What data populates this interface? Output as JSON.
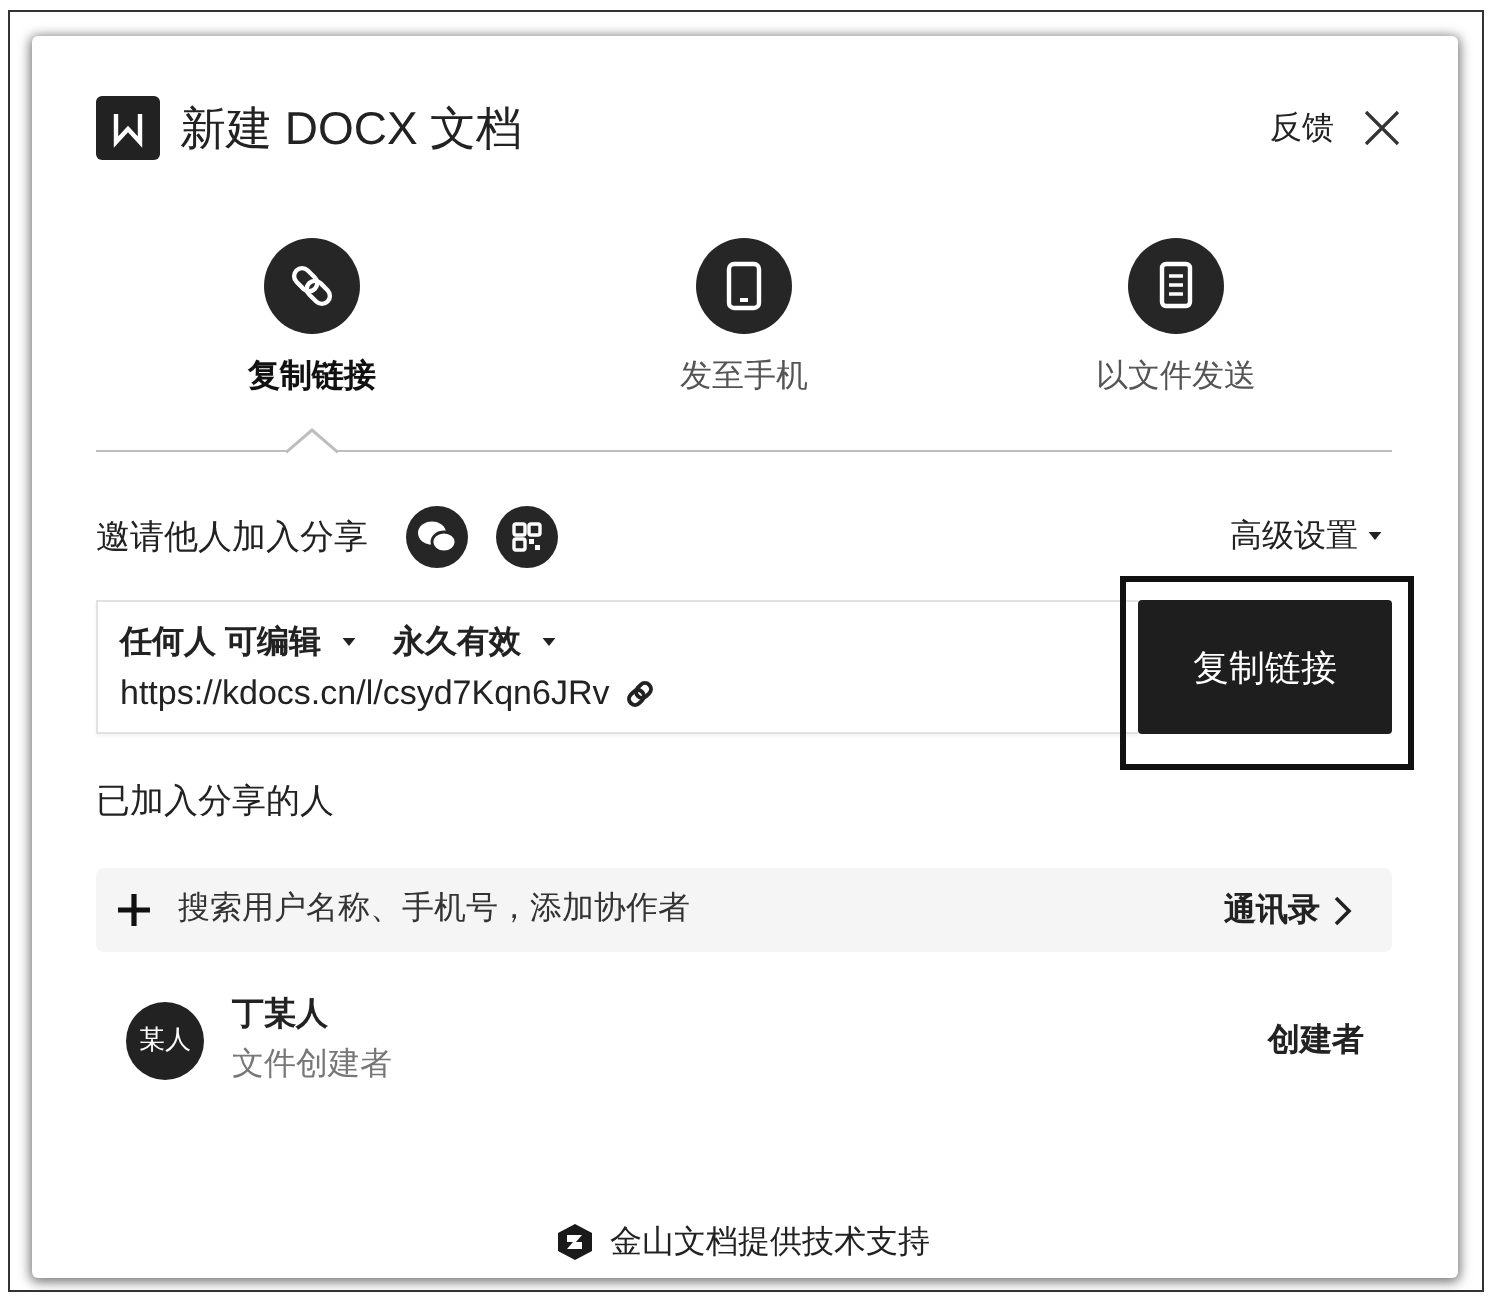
{
  "window": {
    "title": "新建 DOCX 文档",
    "feedback": "反馈"
  },
  "share_modes": [
    {
      "kind": "link",
      "label": "复制链接",
      "selected": true
    },
    {
      "kind": "phone",
      "label": "发至手机",
      "selected": false
    },
    {
      "kind": "file",
      "label": "以文件发送",
      "selected": false
    }
  ],
  "invite": {
    "label": "邀请他人加入分享",
    "advanced": "高级设置"
  },
  "link": {
    "access": "任何人 可编辑",
    "expiry": "永久有效",
    "url": "https://kdocs.cn/l/csyd7Kqn6JRv"
  },
  "copy_button": {
    "label": "复制链接",
    "highlighted": true
  },
  "members_section": {
    "title": "已加入分享的人",
    "search": {
      "placeholder": "搜索用户名称、手机号，添加协作者"
    },
    "contacts": "通讯录"
  },
  "members": [
    {
      "avatar_text": "某人",
      "name": "丁某人",
      "subtitle": "文件创建者",
      "role": "创建者"
    }
  ],
  "footer": "金山文档提供技术支持"
}
